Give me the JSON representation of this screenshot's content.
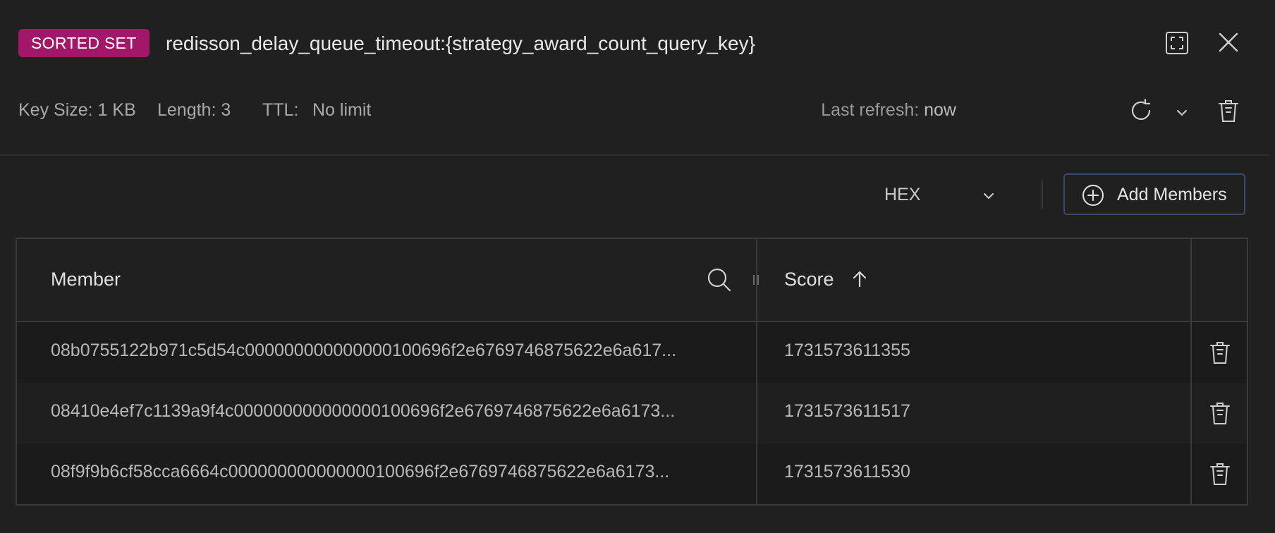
{
  "header": {
    "type_badge": "SORTED SET",
    "key_name": "redisson_delay_queue_timeout:{strategy_award_count_query_key}"
  },
  "meta": {
    "key_size": "Key Size: 1 KB",
    "length": "Length: 3",
    "ttl_label": "TTL:",
    "ttl_value": "No limit",
    "last_refresh_label": "Last refresh:",
    "last_refresh_value": "now"
  },
  "toolbar": {
    "format_value": "HEX",
    "add_members_label": "Add Members"
  },
  "table": {
    "columns": {
      "member": "Member",
      "score": "Score"
    },
    "rows": [
      {
        "member": "08b0755122b971c5d54c000000000000000100696f2e6769746875622e6a617...",
        "score": "1731573611355"
      },
      {
        "member": "08410e4ef7c1139a9f4c000000000000000100696f2e6769746875622e6a6173...",
        "score": "1731573611517"
      },
      {
        "member": "08f9f9b6cf58cca6664c000000000000000100696f2e6769746875622e6a6173...",
        "score": "1731573611530"
      }
    ]
  },
  "icons": {
    "fullscreen": "fullscreen-icon",
    "close": "close-icon",
    "refresh": "refresh-icon",
    "chevron": "chevron-down-icon",
    "delete": "trash-icon",
    "add": "plus-circle-icon",
    "search": "search-icon",
    "sort": "arrow-up-icon"
  },
  "colors": {
    "background": "#202020",
    "badge": "#a31769",
    "button_border": "#3c4a66",
    "border": "#3a3a3a"
  }
}
